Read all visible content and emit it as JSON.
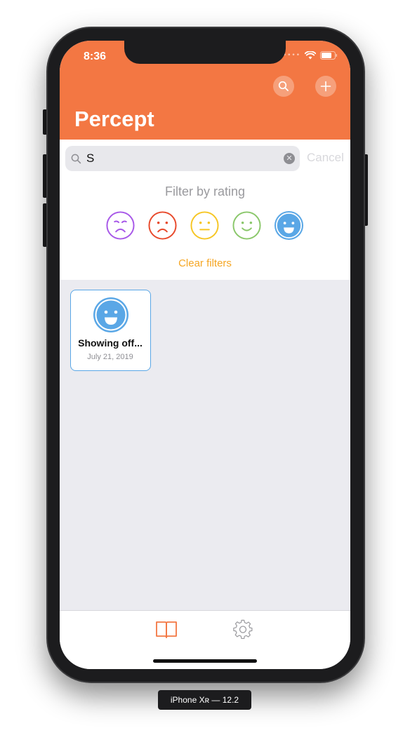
{
  "status_bar": {
    "time": "8:36"
  },
  "header": {
    "title": "Percept",
    "search_icon": "search-icon",
    "add_icon": "plus-icon",
    "color": "#f37743"
  },
  "search": {
    "value": "S",
    "cancel_label": "Cancel"
  },
  "filter": {
    "label": "Filter by rating",
    "ratings": [
      {
        "name": "very-sad",
        "color": "#a757e8",
        "selected": false
      },
      {
        "name": "sad",
        "color": "#e8492b",
        "selected": false
      },
      {
        "name": "neutral",
        "color": "#f6c624",
        "selected": false
      },
      {
        "name": "happy",
        "color": "#8ac76a",
        "selected": false
      },
      {
        "name": "very-happy",
        "color": "#5aa7e6",
        "selected": true
      }
    ],
    "clear_label": "Clear filters",
    "clear_color": "#f5a623"
  },
  "entries": [
    {
      "title": "Showing off...",
      "date": "July 21, 2019",
      "rating": "very-happy"
    }
  ],
  "tabbar": {
    "tabs": [
      {
        "name": "journal",
        "icon": "book-icon",
        "active": true
      },
      {
        "name": "settings",
        "icon": "gear-icon",
        "active": false
      }
    ]
  },
  "device_label": "iPhone Xʀ — 12.2"
}
